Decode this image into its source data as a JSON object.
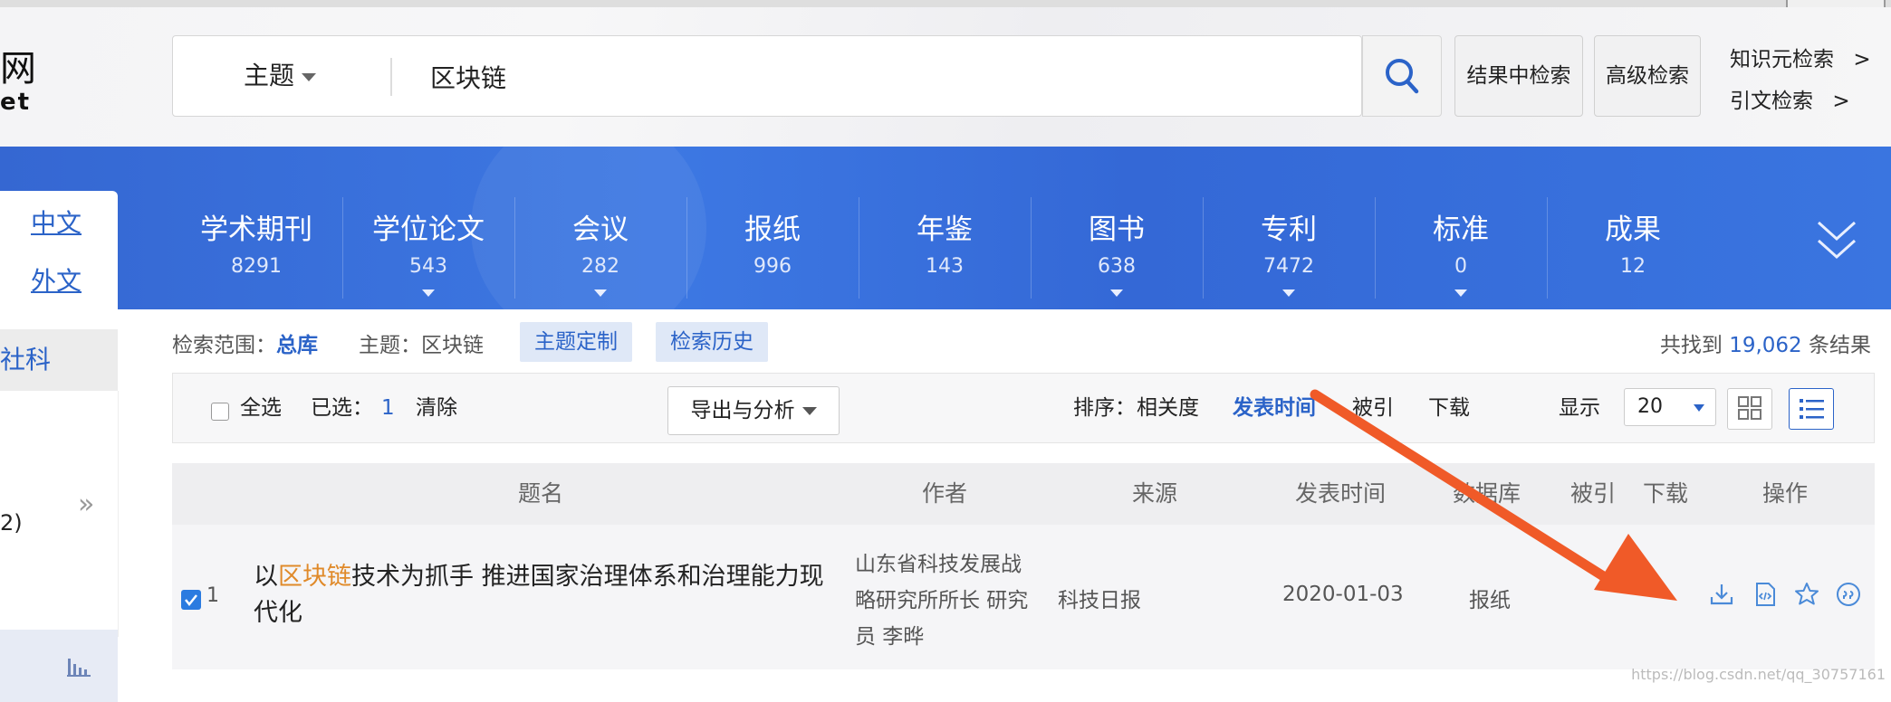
{
  "header": {
    "logo_main": "网",
    "logo_sub": "et",
    "search_type": "主题",
    "search_value": "区块链",
    "btn_in_results": "结果中检索",
    "btn_advanced": "高级检索",
    "link_knowledge": "知识元检索",
    "link_citation": "引文检索",
    "chevron": ">"
  },
  "lang": {
    "zh": "中文",
    "foreign": "外文"
  },
  "categories": [
    {
      "name": "学术期刊",
      "count": "8291",
      "has_arrow": false
    },
    {
      "name": "学位论文",
      "count": "543",
      "has_arrow": true
    },
    {
      "name": "会议",
      "count": "282",
      "has_arrow": true
    },
    {
      "name": "报纸",
      "count": "996",
      "has_arrow": false
    },
    {
      "name": "年鉴",
      "count": "143",
      "has_arrow": false
    },
    {
      "name": "图书",
      "count": "638",
      "has_arrow": true
    },
    {
      "name": "专利",
      "count": "7472",
      "has_arrow": true
    },
    {
      "name": "标准",
      "count": "0",
      "has_arrow": true
    },
    {
      "name": "成果",
      "count": "12",
      "has_arrow": false
    }
  ],
  "left_panel": {
    "selected": "社科",
    "chevron": "»",
    "partial_count": "2)"
  },
  "scope": {
    "label": "检索范围：",
    "value": "总库",
    "topic_label": "主题：",
    "topic_value": "区块链",
    "btn_custom": "主题定制",
    "btn_history": "检索历史",
    "found_prefix": "共找到",
    "found_count": "19,062",
    "found_suffix": "条结果"
  },
  "toolbar": {
    "select_all": "全选",
    "selected_label": "已选：",
    "selected_count": "1",
    "clear": "清除",
    "export": "导出与分析",
    "sort_label": "排序：",
    "sort_relevance": "相关度",
    "sort_date": "发表时间",
    "sort_cited": "被引",
    "sort_download": "下载",
    "display_label": "显示",
    "page_size": "20"
  },
  "table": {
    "headers": [
      "题名",
      "作者",
      "来源",
      "发表时间",
      "数据库",
      "被引",
      "下载",
      "操作"
    ],
    "rows": [
      {
        "index": "1",
        "checked": true,
        "title_pre": "以",
        "title_hl": "区块链",
        "title_post": "技术为抓手 推进国家治理体系和治理能力现代化",
        "author_lines": [
          "山东省科技发展战",
          "略研究所所长 研究",
          "员 李晔"
        ],
        "source": "科技日报",
        "date": "2020-01-03",
        "database": "报纸",
        "cited": "",
        "downloads": ""
      }
    ]
  },
  "watermark": "https://blog.csdn.net/qq_30757161",
  "colors": {
    "banner": "#3a6fd8",
    "link": "#2b63c8",
    "highlight": "#e08a2a",
    "arrow": "#f05a28"
  }
}
